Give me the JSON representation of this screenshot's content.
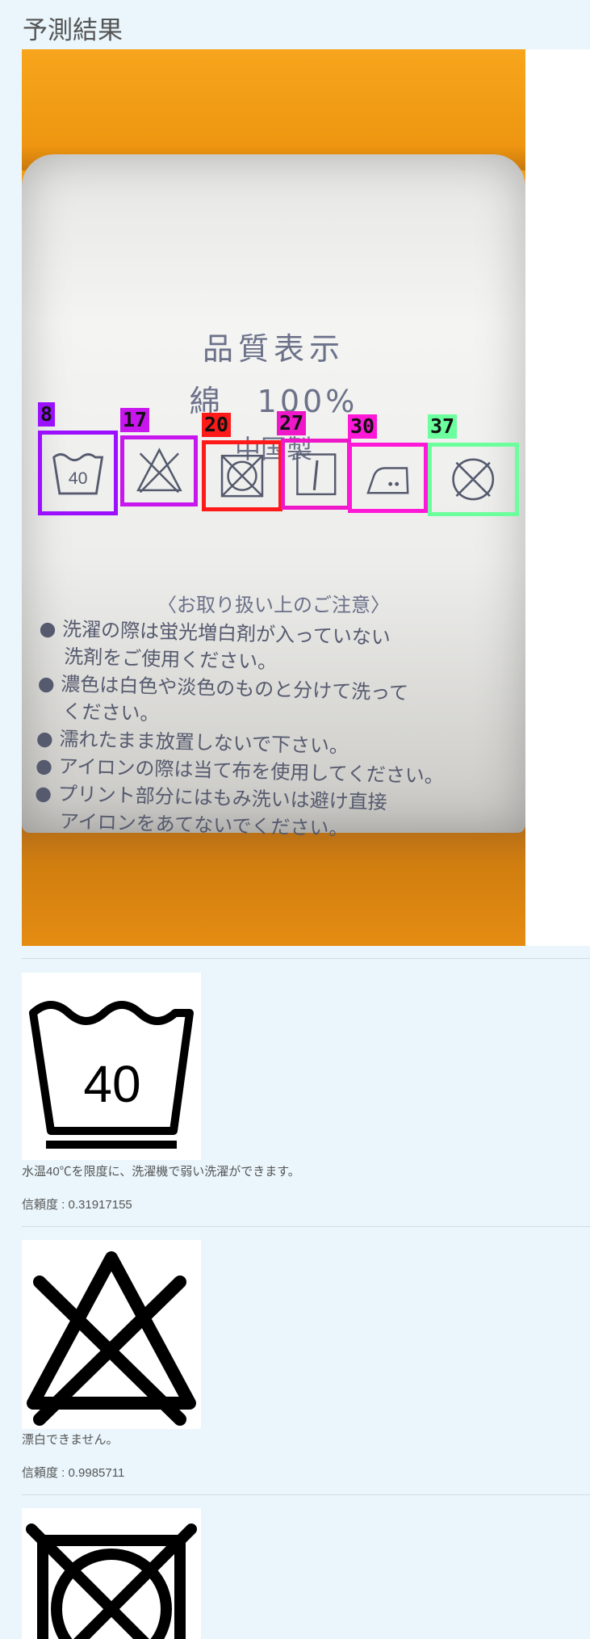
{
  "page": {
    "title": "予測結果"
  },
  "photo": {
    "tag_lines": [
      "品質表示",
      "綿　100%",
      "中国製"
    ],
    "notice_heading": "〈お取り扱い上のご注意〉",
    "notes": [
      "● 洗濯の際は蛍光増白剤が入っていない",
      "　 洗剤をご使用ください。",
      "● 濃色は白色や淡色のものと分けて洗って",
      "　 ください。",
      "● 濡れたまま放置しないで下さい。",
      "● アイロンの際は当て布を使用してください。",
      "● プリント部分にはもみ洗いは避け直接",
      "　 アイロンをあてないでください。"
    ],
    "detections": [
      {
        "label": "8",
        "color": "#9b10ff",
        "icon": "wash-40-icon"
      },
      {
        "label": "17",
        "color": "#c816ee",
        "icon": "no-bleach-icon"
      },
      {
        "label": "20",
        "color": "#ff1a1a",
        "icon": "no-tumble-dry-icon"
      },
      {
        "label": "27",
        "color": "#ee18c8",
        "icon": "line-dry-icon"
      },
      {
        "label": "30",
        "color": "#ff18d8",
        "icon": "iron-low-icon"
      },
      {
        "label": "37",
        "color": "#6bff9e",
        "icon": "no-dry-clean-icon"
      }
    ]
  },
  "results": [
    {
      "icon": "wash-40-icon",
      "wash_temp": "40",
      "description": "水温40℃を限度に、洗濯機で弱い洗濯ができます。",
      "confidence": "信頼度 : 0.31917155"
    },
    {
      "icon": "no-bleach-icon",
      "description": "漂白できません。",
      "confidence": "信頼度 : 0.9985711"
    },
    {
      "icon": "no-tumble-dry-icon"
    }
  ]
}
